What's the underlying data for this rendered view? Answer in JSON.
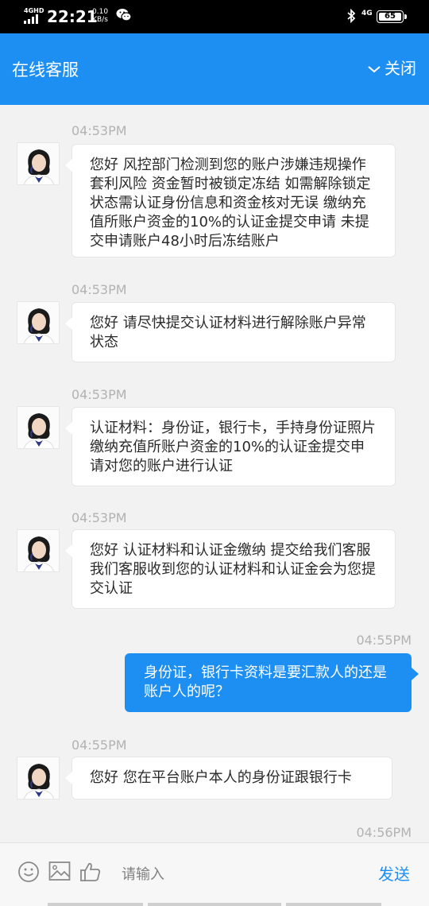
{
  "status_bar": {
    "network_label": "4GHD",
    "time": "22:21",
    "speed_value": "0.10",
    "speed_unit": "KB/s",
    "mobile_network": "4G",
    "battery": "65"
  },
  "header": {
    "title": "在线客服",
    "close_label": "关闭"
  },
  "messages": [
    {
      "time": "04:53PM",
      "text": "您好 风控部门检测到您的账户涉嫌违规操作套利风险 资金暂时被锁定冻结 如需解除锁定状态需认证身份信息和资金核对无误 缴纳充值所账户资金的10%的认证金提交申请 未提交申请账户48小时后冻结账户"
    },
    {
      "time": "04:53PM",
      "text": "您好 请尽快提交认证材料进行解除账户异常状态"
    },
    {
      "time": "04:53PM",
      "text": "认证材料：身份证，银行卡，手持身份证照片 缴纳充值所账户资金的10%的认证金提交申请对您的账户进行认证"
    },
    {
      "time": "04:53PM",
      "text": "您好 认证材料和认证金缴纳 提交给我们客服 我们客服收到您的认证材料和认证金会为您提交认证"
    },
    {
      "time": "04:55PM",
      "text": "身份证，银行卡资料是要汇款人的还是账户人的呢？"
    },
    {
      "time": "04:55PM",
      "text": "您好 您在平台账户本人的身份证跟银行卡"
    },
    {
      "time": "04:56PM",
      "text": ""
    }
  ],
  "input": {
    "placeholder": "请输入",
    "send_label": "发送"
  },
  "colors": {
    "brand_blue": "#1d8ff3",
    "bubble_in": "#ffffff",
    "timestamp": "#b2b2b2"
  }
}
